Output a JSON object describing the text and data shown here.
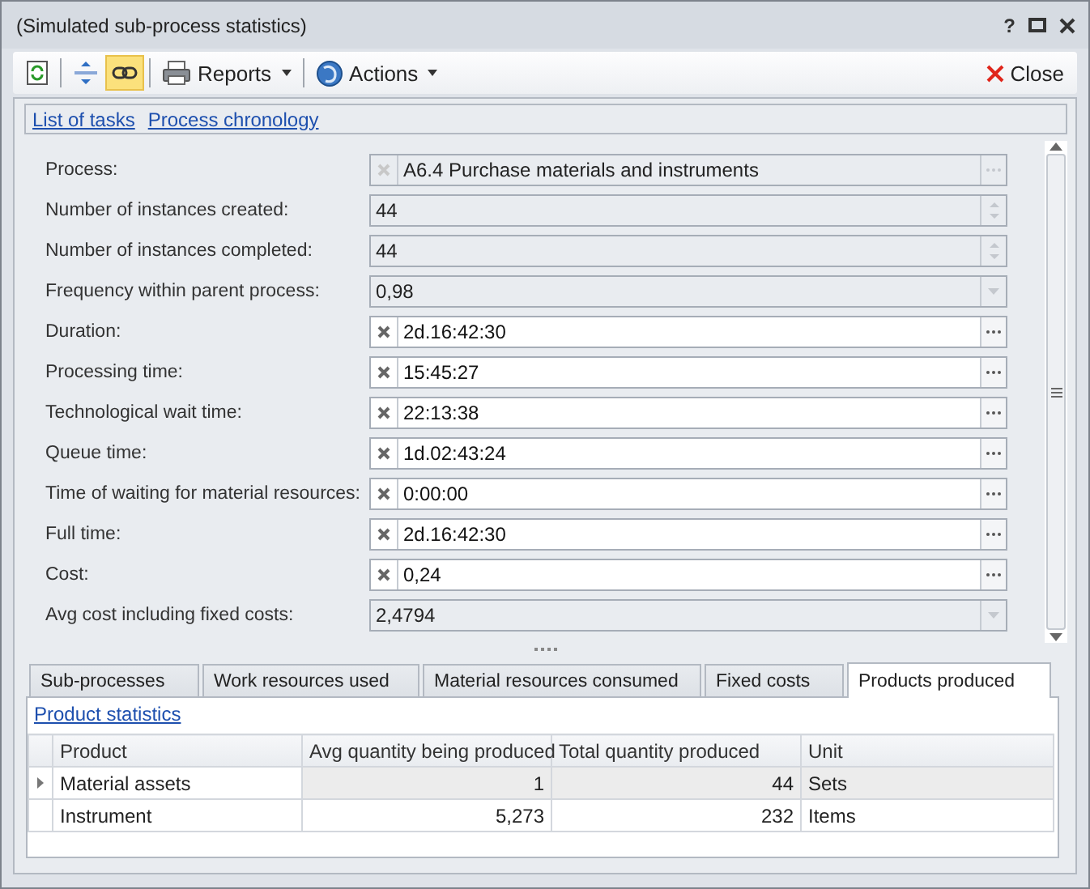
{
  "window": {
    "title": "(Simulated sub-process statistics)",
    "help": "?"
  },
  "toolbar": {
    "items": [
      {
        "kind": "icon",
        "pressed": false
      },
      {
        "kind": "separator"
      },
      {
        "kind": "icon",
        "pressed": false
      },
      {
        "kind": "icon",
        "pressed": true
      },
      {
        "kind": "separator"
      },
      {
        "kind": "menu",
        "label": "Reports"
      },
      {
        "kind": "separator"
      },
      {
        "kind": "menu",
        "label": "Actions"
      }
    ],
    "close": "Close"
  },
  "links": [
    "List of tasks",
    "Process chronology"
  ],
  "fields": [
    {
      "label": "Process:",
      "value": "A6.4 Purchase materials and instruments",
      "kind": "edit",
      "disabled": true
    },
    {
      "label": "Number of instances created:",
      "value": "44",
      "kind": "spin",
      "disabled": true
    },
    {
      "label": "Number of instances completed:",
      "value": "44",
      "kind": "spin",
      "disabled": true
    },
    {
      "label": "Frequency within parent process:",
      "value": "0,98",
      "kind": "combo",
      "disabled": true
    },
    {
      "label": "Duration:",
      "value": "2d.16:42:30",
      "kind": "edit",
      "disabled": false
    },
    {
      "label": "Processing time:",
      "value": "15:45:27",
      "kind": "edit",
      "disabled": false
    },
    {
      "label": "Technological wait time:",
      "value": "22:13:38",
      "kind": "edit",
      "disabled": false
    },
    {
      "label": "Queue time:",
      "value": "1d.02:43:24",
      "kind": "edit",
      "disabled": false
    },
    {
      "label": "Time of waiting for material resources:",
      "value": "0:00:00",
      "kind": "edit",
      "disabled": false
    },
    {
      "label": "Full time:",
      "value": "2d.16:42:30",
      "kind": "edit",
      "disabled": false
    },
    {
      "label": "Cost:",
      "value": "0,24",
      "kind": "edit",
      "disabled": false
    },
    {
      "label": "Avg cost including fixed costs:",
      "value": "2,4794",
      "kind": "combo",
      "disabled": true
    }
  ],
  "tabs": [
    {
      "label": "Sub-processes",
      "selected": false
    },
    {
      "label": "Work resources used",
      "selected": false
    },
    {
      "label": "Material resources consumed",
      "selected": false
    },
    {
      "label": "Fixed costs",
      "selected": false
    },
    {
      "label": "Products produced",
      "selected": true
    }
  ],
  "tab_link": "Product statistics",
  "table": {
    "columns": [
      {
        "label": "Product"
      },
      {
        "label": "Avg quantity being produced"
      },
      {
        "label": "Total quantity produced"
      },
      {
        "label": "Unit"
      }
    ],
    "rows": [
      {
        "cells": [
          "Material assets",
          "1",
          "44",
          "Sets"
        ],
        "selected": true
      },
      {
        "cells": [
          "Instrument",
          "5,273",
          "232",
          "Items"
        ],
        "selected": false
      }
    ]
  }
}
